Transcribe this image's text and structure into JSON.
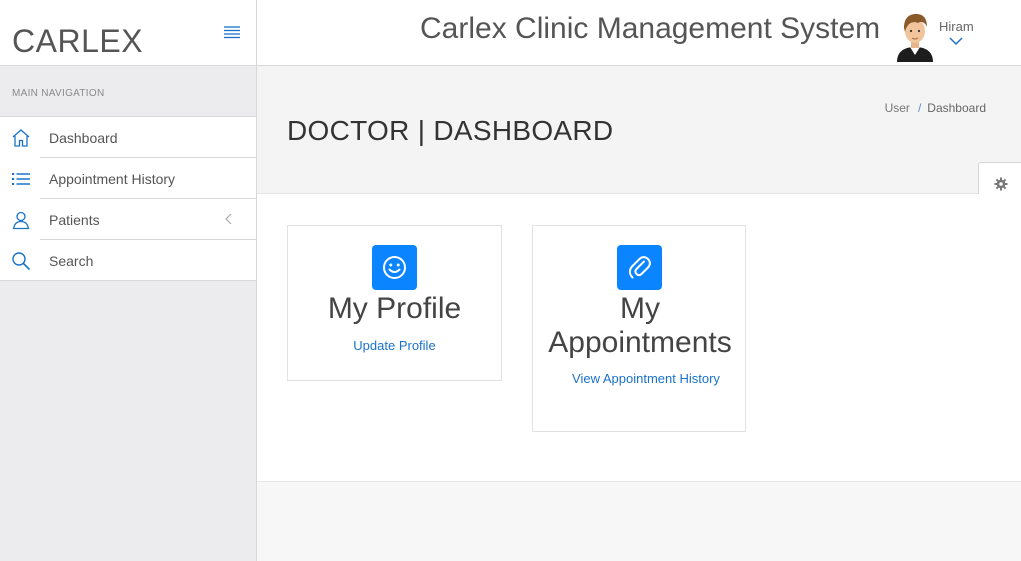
{
  "brand": {
    "name": "CARLEX"
  },
  "sidebar": {
    "section_header": "MAIN NAVIGATION",
    "items": [
      {
        "label": "Dashboard",
        "icon": "home-icon"
      },
      {
        "label": "Appointment History",
        "icon": "list-icon"
      },
      {
        "label": "Patients",
        "icon": "user-icon",
        "expandable": true
      },
      {
        "label": "Search",
        "icon": "search-icon"
      }
    ]
  },
  "header": {
    "title": "Carlex Clinic Management System",
    "user": {
      "name": "Hiram"
    }
  },
  "page": {
    "title": "DOCTOR | DASHBOARD",
    "breadcrumb": [
      "User",
      "Dashboard"
    ]
  },
  "cards": [
    {
      "title": "My Profile",
      "link": "Update Profile",
      "icon": "smile-icon"
    },
    {
      "title_line1": "My",
      "title_line2": "Appointments",
      "link": "View Appointment History",
      "icon": "paperclip-icon"
    }
  ],
  "colors": {
    "accent": "#0a84ff",
    "link": "#1a73c9",
    "sidebar_bg": "#ececef"
  }
}
